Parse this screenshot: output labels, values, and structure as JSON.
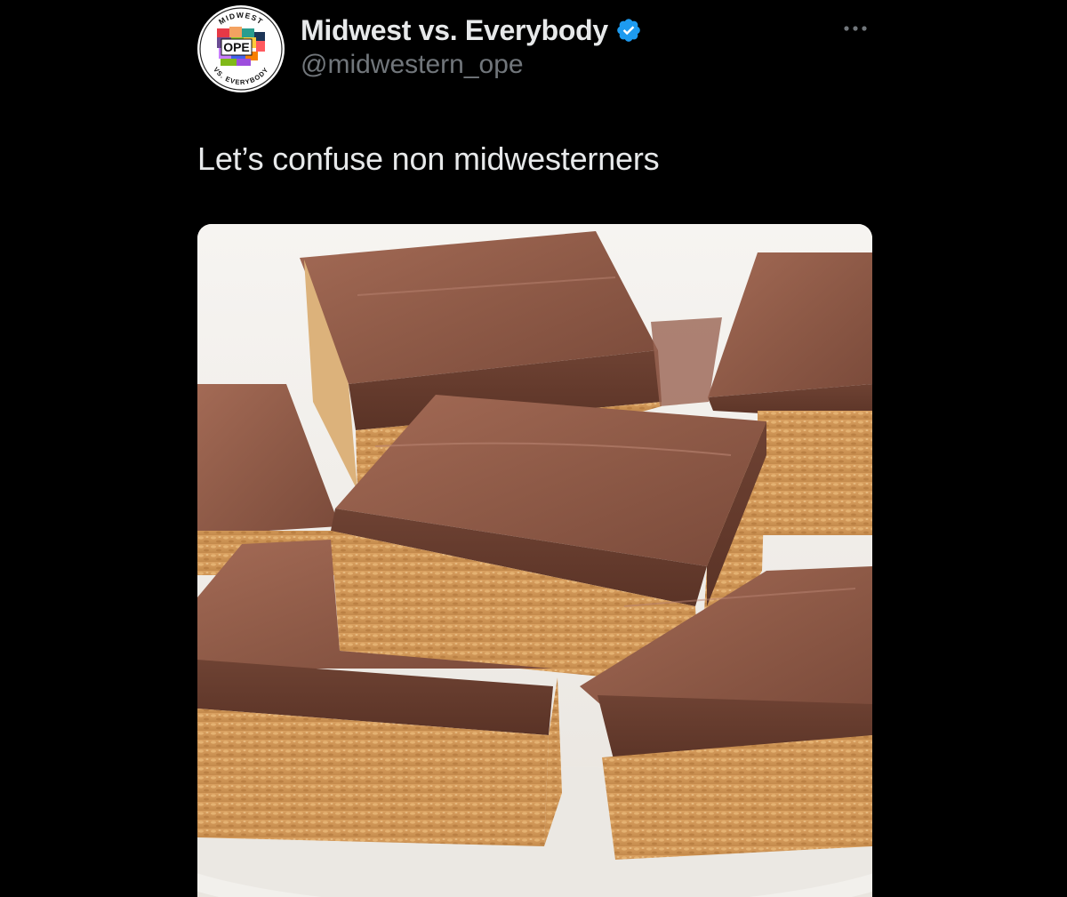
{
  "tweet": {
    "author": {
      "display_name": "Midwest vs. Everybody",
      "handle": "@midwestern_ope",
      "verified": true,
      "avatar": {
        "icon": "midwest-ope-logo",
        "ring_text_top": "MIDWEST",
        "ring_text_bottom": "VS. EVERYBODY",
        "center_text": "OPE"
      }
    },
    "more_icon": "more-horizontal-icon",
    "text": "Let’s confuse non midwesterners",
    "media": {
      "type": "photo",
      "icon": "chocolate-scotcheroos-photo"
    }
  },
  "colors": {
    "background": "#000000",
    "primary_text": "#e7e9ea",
    "secondary_text": "#71767b",
    "verified_blue": "#1d9bf0"
  }
}
